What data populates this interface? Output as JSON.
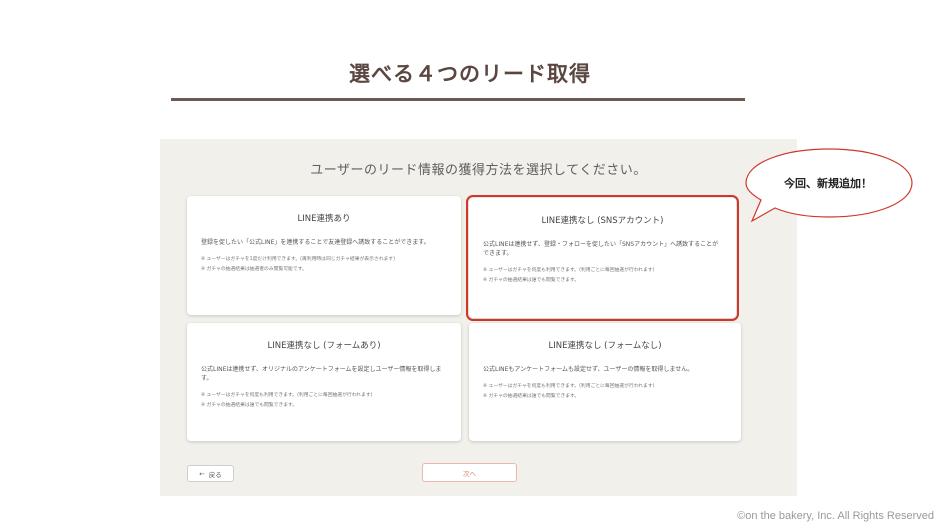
{
  "slide": {
    "title": "選べる４つのリード取得",
    "copyright": "©on the bakery, Inc. All Rights Reserved"
  },
  "callout": {
    "text": "今回、新規追加！"
  },
  "panel": {
    "heading": "ユーザーのリード情報の獲得方法を選択してください。",
    "cards": [
      {
        "title": "LINE連携あり",
        "description": "登録を促したい「公式LINE」を連携することで友達登録へ誘致することができます。",
        "notes": [
          "※ ユーザーはガチャを1度だけ利用できます。(再利用時は同じガチャ結果が表示されます)",
          "※ ガチャの抽選結果は抽選者のみ閲覧可能です。"
        ],
        "highlighted": false
      },
      {
        "title": "LINE連携なし (SNSアカウント)",
        "description": "公式LINEは連携せず、登録・フォローを促したい「SNSアカウント」へ誘致することができます。",
        "notes": [
          "※ ユーザーはガチャを何度も利用できます。(利用ごとに毎回抽選が行われます)",
          "※ ガチャの抽選結果は誰でも閲覧できます。"
        ],
        "highlighted": true
      },
      {
        "title": "LINE連携なし (フォームあり)",
        "description": "公式LINEは連携せず、オリジナルのアンケートフォームを設定しユーザー情報を取得します。",
        "notes": [
          "※ ユーザーはガチャを何度も利用できます。(利用ごとに毎回抽選が行われます)",
          "※ ガチャの抽選結果は誰でも閲覧できます。"
        ],
        "highlighted": false
      },
      {
        "title": "LINE連携なし (フォームなし)",
        "description": "公式LINEもアンケートフォームも設定せず、ユーザーの情報を取得しません。",
        "notes": [
          "※ ユーザーはガチャを何度も利用できます。(利用ごとに毎回抽選が行われます)",
          "※ ガチャの抽選結果は誰でも閲覧できます。"
        ],
        "highlighted": false
      }
    ],
    "back_label": "戻る",
    "back_icon": "arrow-left-icon",
    "next_label": "次へ"
  },
  "colors": {
    "title": "#5b4740",
    "rule": "#6b5a52",
    "panel_bg": "#f2f0eb",
    "highlight": "#d0372b",
    "next_text": "#d9826f"
  }
}
